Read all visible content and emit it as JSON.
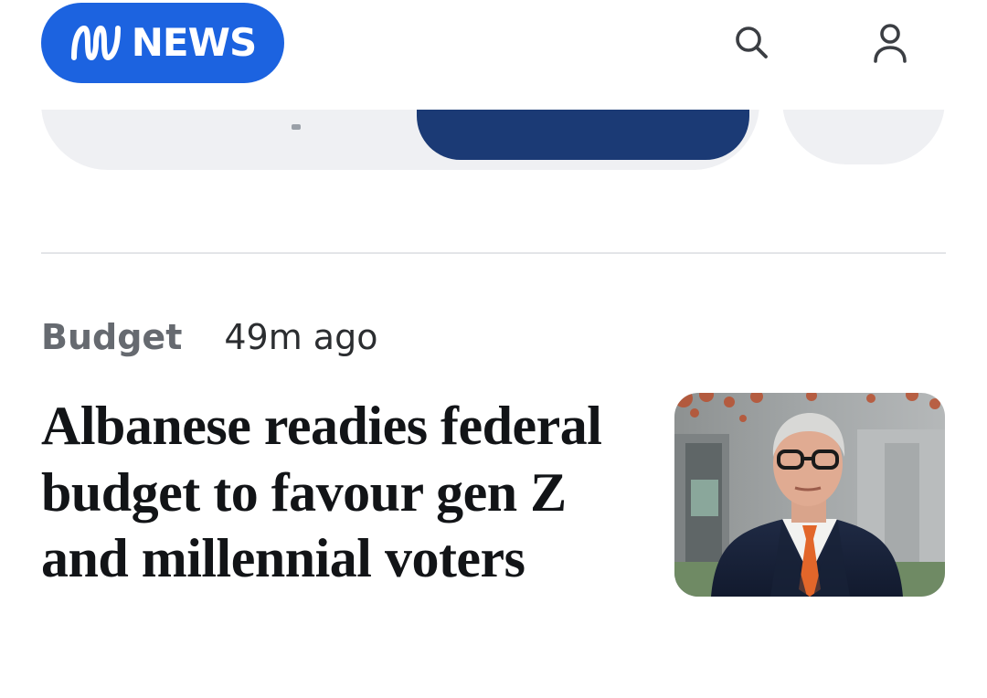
{
  "header": {
    "logo_text": "NEWS",
    "logo_icon": "abc-lissajous-icon",
    "search_icon": "search-icon",
    "account_icon": "user-icon"
  },
  "colors": {
    "brand_blue": "#1c63e0",
    "carousel_bg": "#eff0f3",
    "carousel_active": "#1b3a75",
    "divider": "#e3e5e8",
    "topic_text": "#666a70",
    "headline_text": "#121417"
  },
  "story": {
    "topic": "Budget",
    "timestamp": "49m ago",
    "headline": "Albanese readies federal budget to favour gen Z and millennial voters"
  }
}
